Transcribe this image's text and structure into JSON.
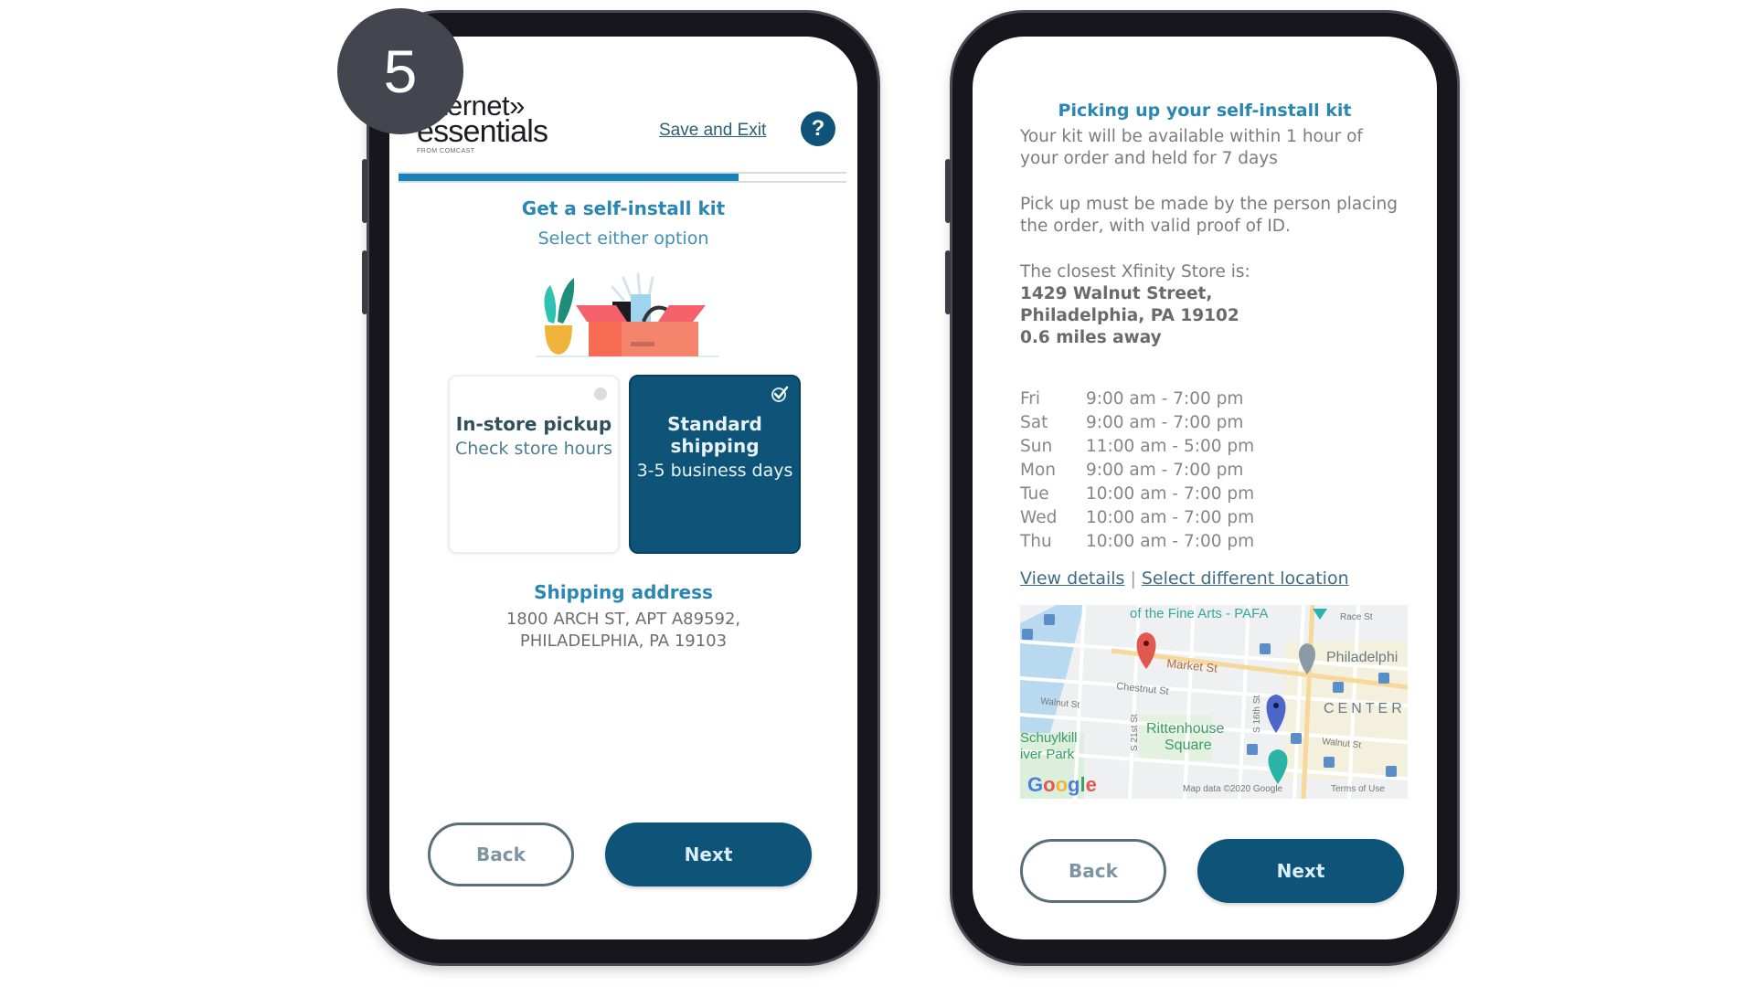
{
  "step_badge": "5",
  "screen1": {
    "logo": {
      "line1": "Internet»",
      "line2": "essentials",
      "line3": "FROM COMCAST"
    },
    "save_exit": "Save and Exit",
    "help_icon": "?",
    "progress_percent": 76,
    "title": "Get a self-install kit",
    "subtitle": "Select either option",
    "options": [
      {
        "title": "In-store pickup",
        "desc": "Check store hours",
        "selected": false
      },
      {
        "title": "Standard shipping",
        "desc": "3-5 business days",
        "selected": true
      }
    ],
    "shipping_label": "Shipping address",
    "shipping_address": [
      "1800 ARCH ST, APT A89592,",
      "PHILADELPHIA, PA 19103"
    ],
    "back_label": "Back",
    "next_label": "Next"
  },
  "screen2": {
    "title": "Picking up your self-install kit",
    "availability": "Your kit will be available within 1 hour of your order and held for 7 days",
    "pickup_note": "Pick up must be made by the person placing the order, with valid proof of ID.",
    "closest_label": "The closest Xfinity Store is:",
    "store_address_line1": "1429 Walnut Street,",
    "store_address_line2": "Philadelphia, PA 19102",
    "distance": "0.6 miles away",
    "hours": [
      {
        "day": "Fri",
        "time": "9:00 am - 7:00 pm"
      },
      {
        "day": "Sat",
        "time": "9:00 am - 7:00 pm"
      },
      {
        "day": "Sun",
        "time": "11:00 am - 5:00 pm"
      },
      {
        "day": "Mon",
        "time": "9:00 am - 7:00 pm"
      },
      {
        "day": "Tue",
        "time": "10:00 am - 7:00 pm"
      },
      {
        "day": "Wed",
        "time": "10:00 am - 7:00 pm"
      },
      {
        "day": "Thu",
        "time": "10:00 am - 7:00 pm"
      }
    ],
    "view_details": "View details",
    "link_separator": "|",
    "select_location": "Select different location",
    "map": {
      "labels": {
        "pafa": "of the Fine Arts - PAFA",
        "race": "Race St",
        "market": "Market St",
        "chestnut": "Chestnut St",
        "walnut_w": "Walnut St",
        "walnut_e": "Walnut St",
        "philadelphia": "Philadelphi",
        "center": "CENTER",
        "rittenhouse1": "Rittenhouse",
        "rittenhouse2": "Square",
        "schuylkill1": "Schuylkill",
        "schuylkill2": "iver Park",
        "s21": "S 21st St",
        "s16": "S 16th St",
        "google": "Google",
        "attribution": "Map data ©2020 Google",
        "terms": "Terms of Use"
      }
    },
    "back_label": "Back",
    "next_label": "Next"
  },
  "colors": {
    "brand_dark": "#0d5478",
    "accent_blue": "#2a86b2",
    "progress_blue": "#1982b8",
    "badge_gray": "#43464f"
  }
}
